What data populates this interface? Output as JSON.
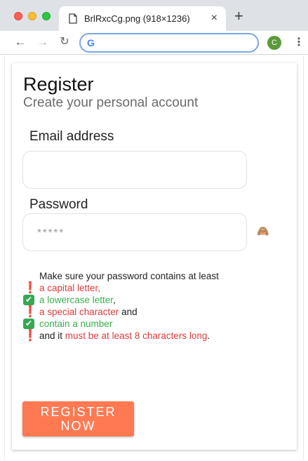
{
  "browser": {
    "tab_title": "BrlRxcCg.png (918×1236)",
    "tab_close": "×",
    "new_tab": "+",
    "back_icon": "←",
    "forward_icon": "→",
    "reload_icon": "↻",
    "search_engine_icon": "G",
    "address_value": "",
    "profile_initial": "C",
    "menu_icon": "⋮"
  },
  "form": {
    "title": "Register",
    "subtitle": "Create your personal account",
    "email_label": "Email address",
    "email_value": "",
    "password_label": "Password",
    "password_placeholder": "*****",
    "password_toggle_icon": "🙈",
    "requirements_intro": "Make sure your password contains at least",
    "requirements": [
      {
        "status": "unmet",
        "icon": "❗",
        "before": "",
        "text": "a capital letter",
        "after": ","
      },
      {
        "status": "met",
        "icon": "✔",
        "before": "",
        "text": "a lowercase letter",
        "after": ","
      },
      {
        "status": "unmet",
        "icon": "❗",
        "before": "",
        "text": "a special character",
        "after": " and"
      },
      {
        "status": "met",
        "icon": "✔",
        "before": "",
        "text": "contain a number",
        "after": ""
      },
      {
        "status": "unmet",
        "icon": "❗",
        "before": "and it ",
        "text": "must be at least 8 characters long",
        "after": "."
      }
    ],
    "submit_label": "REGISTER NOW"
  },
  "colors": {
    "button": "#ff7a52",
    "unmet": "#e03c3c",
    "met": "#3cae4f"
  }
}
